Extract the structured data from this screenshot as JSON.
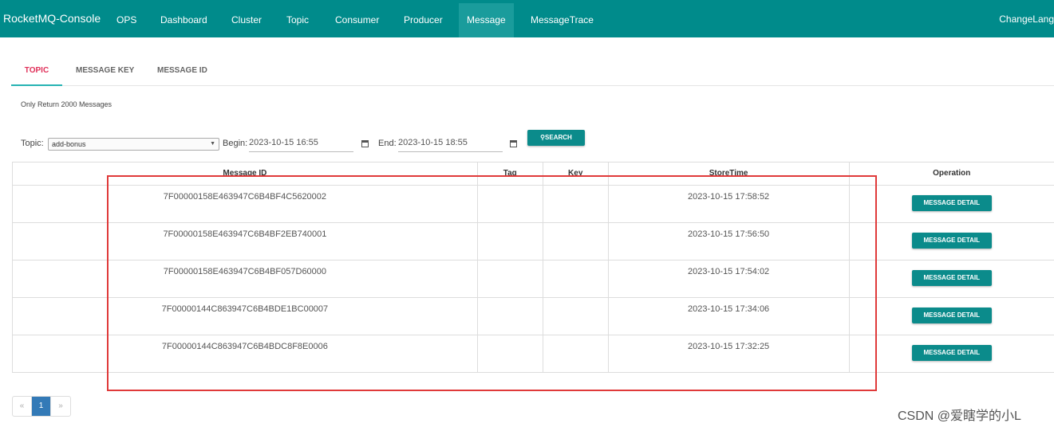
{
  "navbar": {
    "brand": "RocketMQ-Console",
    "items": [
      "OPS",
      "Dashboard",
      "Cluster",
      "Topic",
      "Consumer",
      "Producer",
      "Message",
      "MessageTrace"
    ],
    "active": "Message",
    "right": "ChangeLang"
  },
  "tabs": [
    "TOPIC",
    "MESSAGE KEY",
    "MESSAGE ID"
  ],
  "note": "Only Return 2000 Messages",
  "filter": {
    "topic_label": "Topic:",
    "topic_value": "add-bonus",
    "begin_label": "Begin:",
    "begin_value": "2023-10-15 16:55",
    "end_label": "End:",
    "end_value": "2023-10-15 18:55",
    "search_label": "SEARCH"
  },
  "table": {
    "headers": [
      "Message ID",
      "Tag",
      "Key",
      "StoreTime",
      "Operation"
    ],
    "rows": [
      {
        "id": "7F00000158E463947C6B4BF4C5620002",
        "tag": "",
        "key": "",
        "time": "2023-10-15 17:58:52"
      },
      {
        "id": "7F00000158E463947C6B4BF2EB740001",
        "tag": "",
        "key": "",
        "time": "2023-10-15 17:56:50"
      },
      {
        "id": "7F00000158E463947C6B4BF057D60000",
        "tag": "",
        "key": "",
        "time": "2023-10-15 17:54:02"
      },
      {
        "id": "7F00000144C863947C6B4BDE1BC00007",
        "tag": "",
        "key": "",
        "time": "2023-10-15 17:34:06"
      },
      {
        "id": "7F00000144C863947C6B4BDC8F8E0006",
        "tag": "",
        "key": "",
        "time": "2023-10-15 17:32:25"
      }
    ],
    "detail_label": "MESSAGE DETAIL"
  },
  "pager": {
    "prev": "«",
    "current": "1",
    "next": "»"
  },
  "watermark": "CSDN @爱瞎学的小L",
  "colors": {
    "primary": "#008b8b",
    "button": "#0b8b8b",
    "tab_active_text": "#e0315a",
    "highlight_box": "#e03a3a"
  }
}
